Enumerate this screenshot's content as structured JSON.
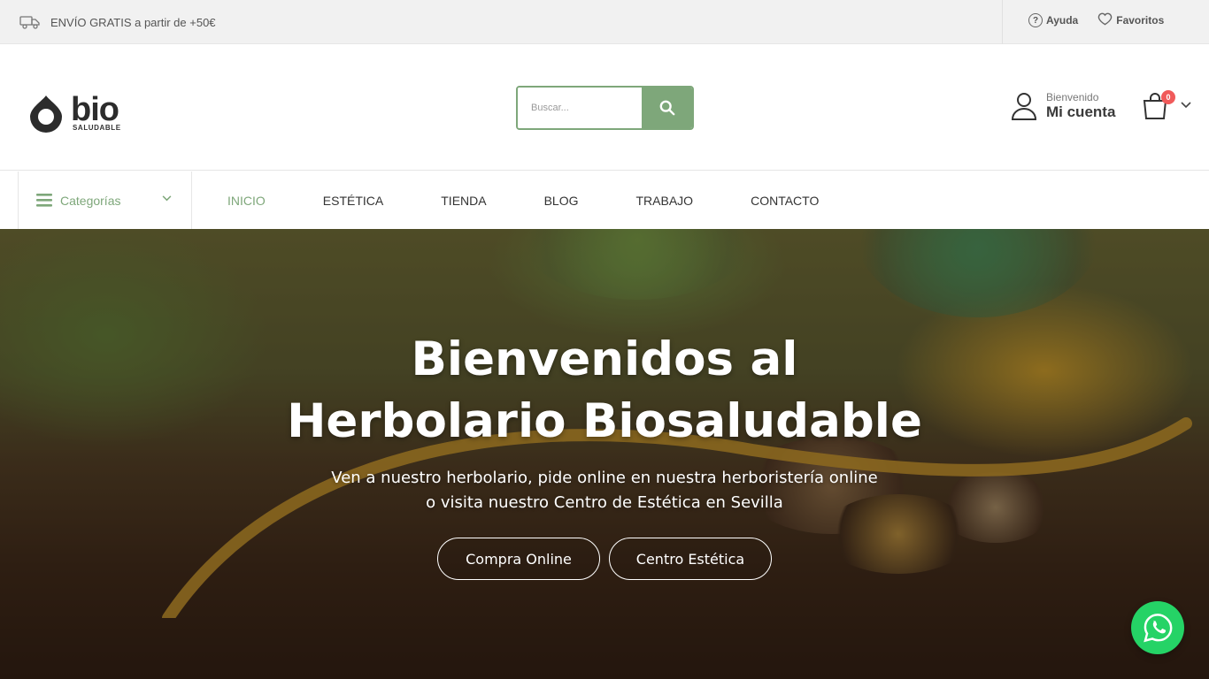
{
  "topbar": {
    "shipping_text": "ENVÍO GRATIS a partir de +50€",
    "help_label": "Ayuda",
    "favorites_label": "Favoritos"
  },
  "header": {
    "logo_text": "bio",
    "logo_subtext": "SALUDABLE",
    "search_placeholder": "Buscar...",
    "account_greeting": "Bienvenido",
    "account_label": "Mi cuenta",
    "cart_count": "0"
  },
  "nav": {
    "categories_label": "Categorías",
    "items": [
      {
        "label": "INICIO",
        "active": true
      },
      {
        "label": "ESTÉTICA"
      },
      {
        "label": "TIENDA"
      },
      {
        "label": "BLOG"
      },
      {
        "label": "TRABAJO"
      },
      {
        "label": "CONTACTO"
      }
    ]
  },
  "hero": {
    "title_line1": "Bienvenidos al",
    "title_line2": "Herbolario Biosaludable",
    "subtitle_line1": "Ven a nuestro herbolario, pide online en nuestra herboristería online",
    "subtitle_line2": "o visita nuestro Centro de Estética en Sevilla",
    "button_shop": "Compra Online",
    "button_aesthetics": "Centro Estética"
  },
  "colors": {
    "accent": "#7ea77a",
    "topbar_bg": "#f1f1f1",
    "badge": "#f05a5a",
    "whatsapp": "#25d366"
  },
  "icons": [
    "truck-icon",
    "help-icon",
    "heart-icon",
    "search-icon",
    "user-icon",
    "cart-icon",
    "hamburger-icon",
    "chevron-down-icon",
    "whatsapp-icon"
  ]
}
